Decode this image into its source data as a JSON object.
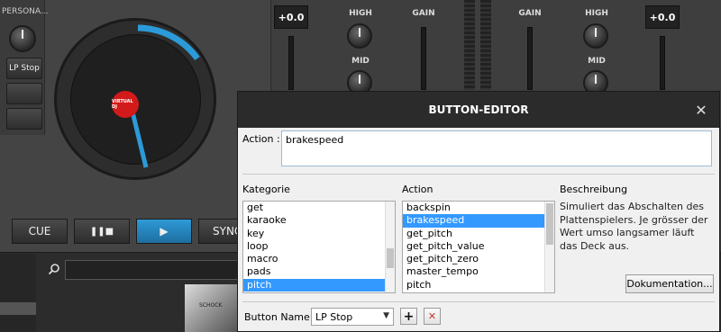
{
  "deck": {
    "panel_title": "PERSONA...",
    "lp_stop_button": "LP Stop",
    "logo_text": "VIRTUAL DJ",
    "transport": {
      "cue": "CUE",
      "pause": "❚❚■",
      "play": "▶",
      "sync": "SYNC"
    }
  },
  "mixer": {
    "left_gain_value": "+0.0",
    "right_gain_value": "+0.0",
    "high_label": "HIGH",
    "mid_label": "MID",
    "gain_label": "GAIN"
  },
  "browser": {
    "search_icon": "search-icon",
    "album_thumb_text": "SCHOCK"
  },
  "dialog": {
    "title": "BUTTON-EDITOR",
    "close_glyph": "✕",
    "action_label": "Action :",
    "action_value": "brakespeed",
    "kategorie_label": "Kategorie",
    "action_list_label": "Action",
    "beschreibung_label": "Beschreibung",
    "kategorie_items": [
      "get",
      "karaoke",
      "key",
      "loop",
      "macro",
      "pads",
      "pitch"
    ],
    "kategorie_selected": "pitch",
    "action_items": [
      "backspin",
      "brakespeed",
      "get_pitch",
      "get_pitch_value",
      "get_pitch_zero",
      "master_tempo",
      "pitch"
    ],
    "action_selected": "brakespeed",
    "description": "Simuliert das Abschalten des Plattenspielers. Je grösser der Wert umso langsamer läuft das Deck aus.",
    "doc_button": "Dokumentation...",
    "button_name_label": "Button Name :",
    "button_name_value": "LP Stop",
    "add_glyph": "+",
    "delete_glyph": "✕"
  },
  "colors": {
    "accent": "#3399ff",
    "deck_blue": "#2c9ad8",
    "delete_red": "#c0392b"
  }
}
